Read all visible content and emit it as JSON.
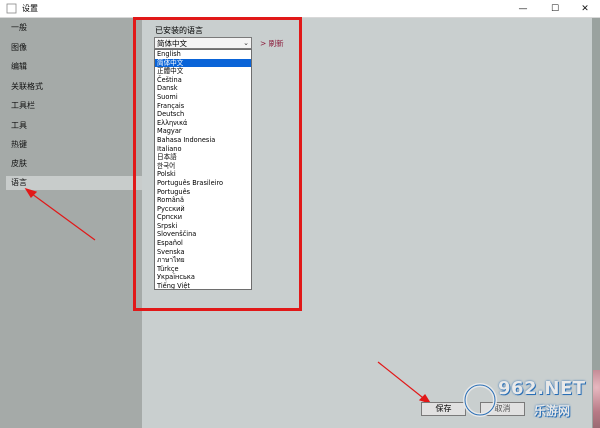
{
  "window": {
    "title": "设置",
    "minimize": "—",
    "maximize": "☐",
    "close": "✕"
  },
  "sidebar": {
    "items": [
      {
        "label": "一般"
      },
      {
        "label": "图像"
      },
      {
        "label": "编辑"
      },
      {
        "label": "关联格式"
      },
      {
        "label": "工具栏"
      },
      {
        "label": "工具"
      },
      {
        "label": "热键"
      },
      {
        "label": "皮肤"
      },
      {
        "label": "语言",
        "selected": true
      }
    ]
  },
  "language": {
    "label": "已安装的语言",
    "selected": "简体中文",
    "refresh": "> 刷新",
    "options": [
      "English",
      "简体中文",
      "正體中文",
      "Čeština",
      "Dansk",
      "Suomi",
      "Français",
      "Deutsch",
      "Ελληνικά",
      "Magyar",
      "Bahasa Indonesia",
      "Italiano",
      "日本語",
      "한국어",
      "Polski",
      "Português Brasileiro",
      "Português",
      "Română",
      "Русский",
      "Српски",
      "Srpski",
      "Slovenščina",
      "Español",
      "Svenska",
      "ภาษาไทย",
      "Türkçe",
      "Українська",
      "Tiếng Việt"
    ],
    "selected_index": 1
  },
  "buttons": {
    "save": "保存",
    "cancel": "取消"
  },
  "watermark": {
    "brand": "962.NET",
    "sub": "乐游网"
  },
  "colors": {
    "highlight": "#e11818",
    "selection": "#0a64d8",
    "accent": "#8a1a3a"
  }
}
